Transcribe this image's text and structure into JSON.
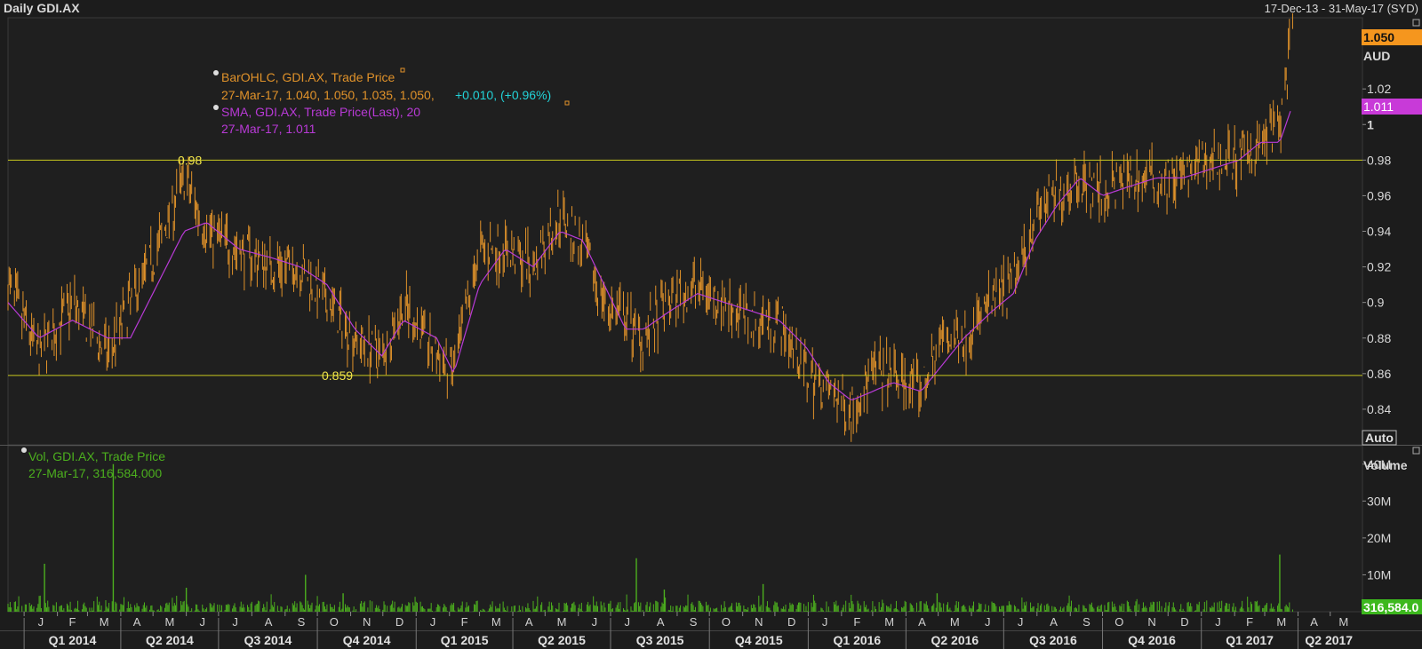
{
  "header": {
    "title": "Daily GDI.AX",
    "date_range": "17-Dec-13 - 31-May-17 (SYD)"
  },
  "price_panel": {
    "currency": "AUD",
    "last_price_badge": "1.050",
    "sma_badge": "1.011",
    "auto_button": "Auto",
    "legend": {
      "ohlc_name": "BarOHLC, GDI.AX, Trade Price",
      "ohlc_values": "27-Mar-17, 1.040, 1.050, 1.035, 1.050,",
      "ohlc_change": "+0.010, (+0.96%)",
      "sma_name": "SMA, GDI.AX, Trade Price(Last),  20",
      "sma_values": "27-Mar-17, 1.011"
    },
    "levels": [
      {
        "label": "0.98",
        "value": 0.98
      },
      {
        "label": "0.859",
        "value": 0.859
      }
    ]
  },
  "volume_panel": {
    "title": "Volume",
    "legend_name": "Vol, GDI.AX, Trade Price",
    "legend_values": "27-Mar-17, 316,584.000",
    "last_badge": "316,584.0"
  },
  "colors": {
    "background": "#1c1c1c",
    "ohlc": "#e0922a",
    "sma": "#b83ad6",
    "level_line": "#c8c81e",
    "volume": "#4caf1e",
    "change_text": "#22d3d8",
    "badge_orange": "#f5961e",
    "badge_magenta": "#c83ad8",
    "badge_green": "#3db81e"
  },
  "chart_data": [
    {
      "type": "line",
      "name": "price",
      "ylim": [
        0.82,
        1.06
      ],
      "yticks": [
        0.84,
        0.86,
        0.88,
        0.9,
        0.92,
        0.94,
        0.96,
        0.98,
        1,
        1.02
      ],
      "ytick_labels": [
        "0.84",
        "0.86",
        "0.88",
        "0.9",
        "0.92",
        "0.94",
        "0.96",
        "0.98",
        "1",
        "1.02"
      ],
      "grid": false,
      "x": [
        "2013-12-17",
        "2014-01-15",
        "2014-02-15",
        "2014-03-20",
        "2014-04-10",
        "2014-05-05",
        "2014-05-30",
        "2014-06-20",
        "2014-07-20",
        "2014-08-20",
        "2014-09-15",
        "2014-10-10",
        "2014-11-05",
        "2014-11-30",
        "2014-12-20",
        "2015-01-20",
        "2015-02-05",
        "2015-03-01",
        "2015-03-25",
        "2015-04-20",
        "2015-05-15",
        "2015-06-05",
        "2015-06-25",
        "2015-07-15",
        "2015-08-01",
        "2015-08-25",
        "2015-09-20",
        "2015-10-15",
        "2015-11-10",
        "2015-12-05",
        "2015-12-30",
        "2016-01-20",
        "2016-02-10",
        "2016-03-01",
        "2016-03-20",
        "2016-04-15",
        "2016-05-05",
        "2016-05-25",
        "2016-06-20",
        "2016-07-10",
        "2016-07-30",
        "2016-08-20",
        "2016-09-10",
        "2016-10-01",
        "2016-10-25",
        "2016-11-20",
        "2016-12-15",
        "2017-01-10",
        "2017-02-05",
        "2017-02-25",
        "2017-03-15",
        "2017-03-27"
      ],
      "series": [
        {
          "values": [
            0.91,
            0.87,
            0.9,
            0.87,
            0.9,
            0.93,
            0.97,
            0.94,
            0.93,
            0.92,
            0.92,
            0.9,
            0.88,
            0.87,
            0.9,
            0.87,
            0.86,
            0.93,
            0.93,
            0.92,
            0.95,
            0.93,
            0.9,
            0.89,
            0.88,
            0.9,
            0.91,
            0.9,
            0.89,
            0.89,
            0.86,
            0.85,
            0.84,
            0.86,
            0.86,
            0.85,
            0.88,
            0.88,
            0.9,
            0.91,
            0.95,
            0.96,
            0.97,
            0.96,
            0.97,
            0.97,
            0.97,
            0.98,
            0.98,
            0.99,
            1.0,
            1.05
          ]
        },
        {
          "name": "SMA 20",
          "values": [
            0.9,
            0.88,
            0.89,
            0.88,
            0.88,
            0.91,
            0.94,
            0.945,
            0.93,
            0.925,
            0.92,
            0.91,
            0.885,
            0.87,
            0.89,
            0.88,
            0.86,
            0.91,
            0.93,
            0.92,
            0.94,
            0.935,
            0.91,
            0.885,
            0.885,
            0.895,
            0.905,
            0.9,
            0.895,
            0.89,
            0.875,
            0.855,
            0.845,
            0.85,
            0.855,
            0.85,
            0.865,
            0.88,
            0.895,
            0.905,
            0.935,
            0.955,
            0.97,
            0.96,
            0.965,
            0.97,
            0.97,
            0.975,
            0.98,
            0.99,
            0.99,
            1.011
          ]
        }
      ]
    },
    {
      "type": "bar",
      "name": "volume",
      "ylim": [
        0,
        45000000
      ],
      "yticks": [
        10000000,
        20000000,
        30000000,
        40000000
      ],
      "ytick_labels": [
        "10M",
        "20M",
        "30M",
        "40M"
      ],
      "x": [
        "2014-01-20",
        "2014-03-25",
        "2014-06-01",
        "2014-09-20",
        "2014-10-25",
        "2015-07-25",
        "2015-08-20",
        "2015-11-20",
        "2016-04-30",
        "2017-03-15"
      ],
      "values": [
        13000000,
        40000000,
        6500000,
        10000000,
        5000000,
        14500000,
        6000000,
        7500000,
        5000000,
        15500000
      ],
      "baseline_max": 3000000
    }
  ],
  "x_axis": {
    "months": [
      {
        "label": "J",
        "date": "2014-01-01"
      },
      {
        "label": "F",
        "date": "2014-02-01"
      },
      {
        "label": "M",
        "date": "2014-03-01"
      },
      {
        "label": "A",
        "date": "2014-04-01"
      },
      {
        "label": "M",
        "date": "2014-05-01"
      },
      {
        "label": "J",
        "date": "2014-06-01"
      },
      {
        "label": "J",
        "date": "2014-07-01"
      },
      {
        "label": "A",
        "date": "2014-08-01"
      },
      {
        "label": "S",
        "date": "2014-09-01"
      },
      {
        "label": "O",
        "date": "2014-10-01"
      },
      {
        "label": "N",
        "date": "2014-11-01"
      },
      {
        "label": "D",
        "date": "2014-12-01"
      },
      {
        "label": "J",
        "date": "2015-01-01"
      },
      {
        "label": "F",
        "date": "2015-02-01"
      },
      {
        "label": "M",
        "date": "2015-03-01"
      },
      {
        "label": "A",
        "date": "2015-04-01"
      },
      {
        "label": "M",
        "date": "2015-05-01"
      },
      {
        "label": "J",
        "date": "2015-06-01"
      },
      {
        "label": "J",
        "date": "2015-07-01"
      },
      {
        "label": "A",
        "date": "2015-08-01"
      },
      {
        "label": "S",
        "date": "2015-09-01"
      },
      {
        "label": "O",
        "date": "2015-10-01"
      },
      {
        "label": "N",
        "date": "2015-11-01"
      },
      {
        "label": "D",
        "date": "2015-12-01"
      },
      {
        "label": "J",
        "date": "2016-01-01"
      },
      {
        "label": "F",
        "date": "2016-02-01"
      },
      {
        "label": "M",
        "date": "2016-03-01"
      },
      {
        "label": "A",
        "date": "2016-04-01"
      },
      {
        "label": "M",
        "date": "2016-05-01"
      },
      {
        "label": "J",
        "date": "2016-06-01"
      },
      {
        "label": "J",
        "date": "2016-07-01"
      },
      {
        "label": "A",
        "date": "2016-08-01"
      },
      {
        "label": "S",
        "date": "2016-09-01"
      },
      {
        "label": "O",
        "date": "2016-10-01"
      },
      {
        "label": "N",
        "date": "2016-11-01"
      },
      {
        "label": "D",
        "date": "2016-12-01"
      },
      {
        "label": "J",
        "date": "2017-01-01"
      },
      {
        "label": "F",
        "date": "2017-02-01"
      },
      {
        "label": "M",
        "date": "2017-03-01"
      },
      {
        "label": "A",
        "date": "2017-04-01"
      },
      {
        "label": "M",
        "date": "2017-05-01"
      }
    ],
    "quarters": [
      {
        "label": "Q1 2014",
        "date": "2014-01-01"
      },
      {
        "label": "Q2 2014",
        "date": "2014-04-01"
      },
      {
        "label": "Q3 2014",
        "date": "2014-07-01"
      },
      {
        "label": "Q4 2014",
        "date": "2014-10-01"
      },
      {
        "label": "Q1 2015",
        "date": "2015-01-01"
      },
      {
        "label": "Q2 2015",
        "date": "2015-04-01"
      },
      {
        "label": "Q3 2015",
        "date": "2015-07-01"
      },
      {
        "label": "Q4 2015",
        "date": "2015-10-01"
      },
      {
        "label": "Q1 2016",
        "date": "2016-01-01"
      },
      {
        "label": "Q2 2016",
        "date": "2016-04-01"
      },
      {
        "label": "Q3 2016",
        "date": "2016-07-01"
      },
      {
        "label": "Q4 2016",
        "date": "2016-10-01"
      },
      {
        "label": "Q1 2017",
        "date": "2017-01-01"
      },
      {
        "label": "Q2 2017",
        "date": "2017-04-01"
      }
    ]
  }
}
